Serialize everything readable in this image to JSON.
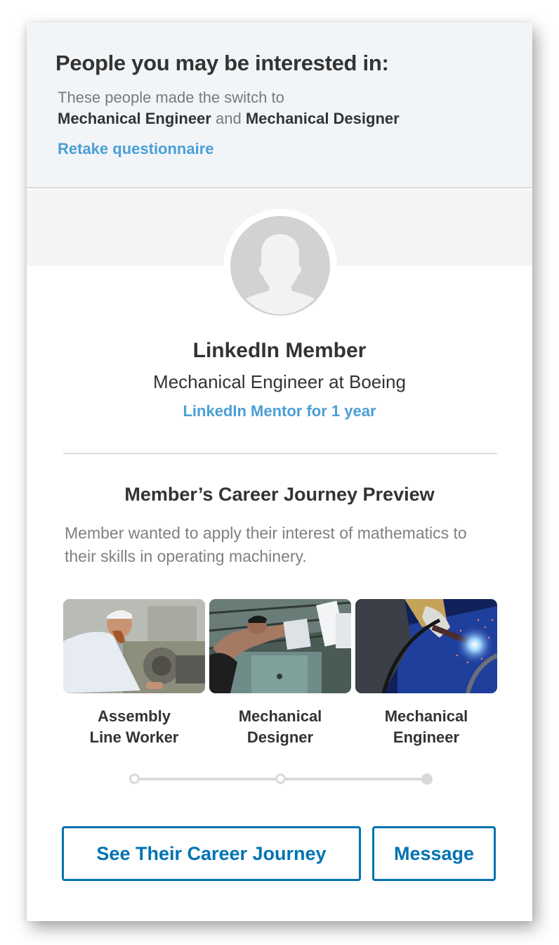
{
  "header": {
    "title": "People you may be interested in:",
    "subtitle_prefix": "These people made the switch to",
    "role_a": "Mechanical Engineer",
    "conjunction": "and",
    "role_b": "Mechanical Designer",
    "retake_link": "Retake questionnaire"
  },
  "profile": {
    "avatar_icon": "default-person-icon",
    "name": "LinkedIn Member",
    "role": "Mechanical Engineer at Boeing",
    "mentor_status": "LinkedIn Mentor for 1 year"
  },
  "journey": {
    "title": "Member’s Career Journey Preview",
    "description": "Member wanted to apply their interest of mathematics to their skills in operating machinery.",
    "steps": [
      {
        "line1": "Assembly",
        "line2": "Line Worker",
        "image": "lathe-worker-photo",
        "state": "past"
      },
      {
        "line1": "Mechanical",
        "line2": "Designer",
        "image": "machine-operator-photo",
        "state": "past"
      },
      {
        "line1": "Mechanical",
        "line2": "Engineer",
        "image": "welder-photo",
        "state": "current"
      }
    ]
  },
  "actions": {
    "primary": "See Their Career Journey",
    "secondary": "Message"
  },
  "colors": {
    "link": "#4a9fd6",
    "button": "#0073b1",
    "header_bg": "#f2f5f8",
    "text": "#333333",
    "muted": "#7a7a7a",
    "timeline": "#d9d9d9"
  }
}
